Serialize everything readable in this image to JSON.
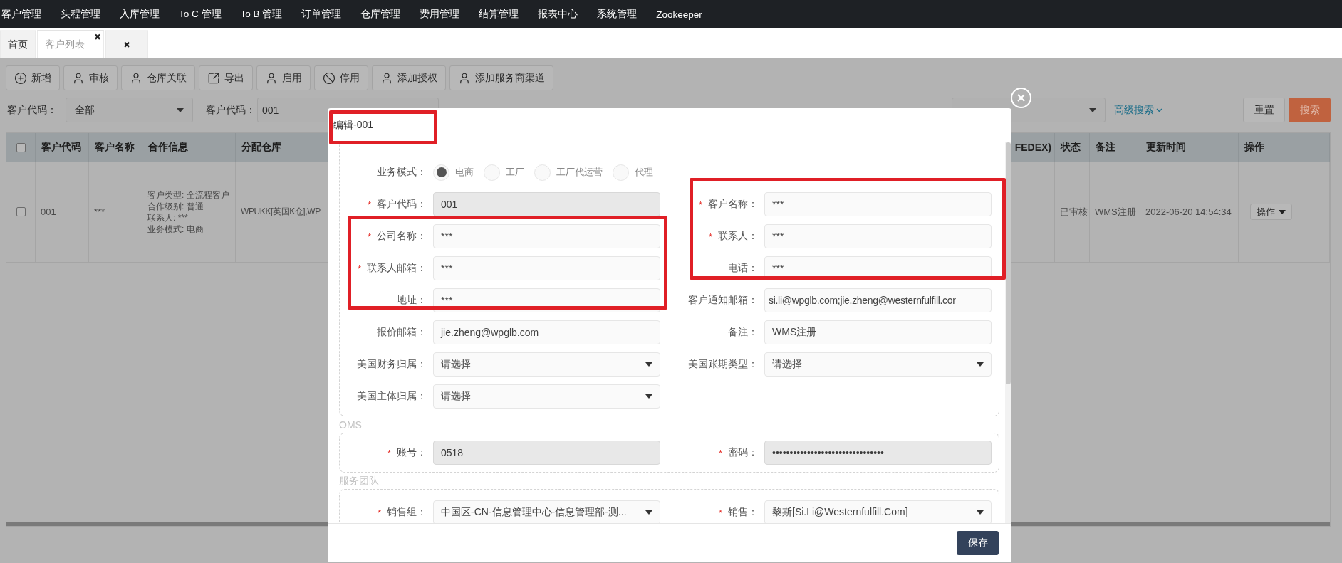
{
  "nav": {
    "items": [
      "客户管理",
      "头程管理",
      "入库管理",
      "To C 管理",
      "To B 管理",
      "订单管理",
      "仓库管理",
      "费用管理",
      "结算管理",
      "报表中心",
      "系统管理",
      "Zookeeper"
    ]
  },
  "tabs": [
    {
      "label": "首页",
      "selected": false
    },
    {
      "label": "客户列表",
      "selected": true,
      "close": "✖"
    },
    {
      "selected": false,
      "close": "✖"
    }
  ],
  "toolbar": [
    {
      "kind": "add",
      "label": "新增"
    },
    {
      "kind": "user",
      "label": "审核"
    },
    {
      "kind": "user",
      "label": "仓库关联"
    },
    {
      "kind": "export",
      "label": "导出"
    },
    {
      "kind": "user",
      "label": "启用"
    },
    {
      "kind": "ban",
      "label": "停用"
    },
    {
      "kind": "user",
      "label": "添加授权"
    },
    {
      "kind": "user",
      "label": "添加服务商渠道"
    }
  ],
  "filters": [
    {
      "kind": "select",
      "label": "客户代码：",
      "value": "全部"
    },
    {
      "kind": "input",
      "label": "客户代码：",
      "value": "001"
    },
    {
      "kind": "select"
    }
  ],
  "advanced_search": "高级搜索",
  "buttons": [
    {
      "kind": "reset",
      "label": "重置"
    },
    {
      "kind": "search",
      "label": "搜索"
    }
  ],
  "table": {
    "header_checked": false,
    "columns": [
      "客户代码",
      "客户名称",
      "合作信息",
      "分配仓库",
      "FEDEX)",
      "状态",
      "备注",
      "更新时间",
      "操作"
    ],
    "rows": [
      {
        "checked": false,
        "cells": [
          "001",
          "***",
          [
            "客户类型: 全流程客户",
            "合作级别: 普通",
            "联系人: ***",
            "业务模式: 电商"
          ],
          "WPUKK[英国K仓],WP",
          null,
          "已审核",
          "WMS注册",
          "2022-06-20 14:54:34"
        ],
        "action": "操作"
      }
    ]
  },
  "modal": {
    "title": "编辑-001",
    "save": "保存",
    "highlights": [
      {
        "kind": "title"
      },
      {
        "kind": "left-group"
      },
      {
        "kind": "right-group"
      }
    ],
    "sections": [
      {
        "rows": [
          {
            "left": {
              "kind": "radio",
              "label": "业务模式：",
              "options": [
                {
                  "label": "电商",
                  "selected": true
                },
                {
                  "label": "工厂",
                  "selected": false
                },
                {
                  "label": "工厂代运营",
                  "selected": false
                },
                {
                  "label": "代理",
                  "selected": false
                }
              ]
            }
          },
          {
            "left": {
              "kind": "input",
              "mark": "*",
              "label": "客户代码：",
              "value": "001",
              "disabled": true
            },
            "right": {
              "kind": "input",
              "mark": "*",
              "label": "客户名称：",
              "value": "***",
              "disabled": false
            }
          },
          {
            "left": {
              "kind": "input",
              "mark": "*",
              "label": "公司名称：",
              "value": "***",
              "disabled": false
            },
            "right": {
              "kind": "input",
              "mark": "*",
              "label": "联系人：",
              "value": "***",
              "disabled": false
            }
          },
          {
            "left": {
              "kind": "input",
              "mark": "*",
              "label": "联系人邮箱：",
              "value": "***",
              "disabled": false
            },
            "right": {
              "kind": "input",
              "label": "电话：",
              "value": "***",
              "disabled": false
            }
          },
          {
            "left": {
              "kind": "input",
              "label": "地址：",
              "value": "***",
              "disabled": false
            },
            "right": {
              "kind": "input",
              "label": "客户通知邮箱：",
              "value": "si.li@wpglb.com;jie.zheng@westernfulfill.cor",
              "disabled": false
            }
          },
          {
            "left": {
              "kind": "input",
              "label": "报价邮箱：",
              "value": "jie.zheng@wpglb.com",
              "disabled": false
            },
            "right": {
              "kind": "input",
              "label": "备注：",
              "value": "WMS注册",
              "disabled": false
            }
          },
          {
            "left": {
              "kind": "select",
              "label": "美国财务归属：",
              "value": "请选择"
            },
            "right": {
              "kind": "select",
              "label": "美国账期类型：",
              "value": "请选择"
            }
          },
          {
            "left": {
              "kind": "select",
              "label": "美国主体归属：",
              "value": "请选择"
            }
          }
        ]
      },
      {
        "title": "OMS",
        "rows": [
          {
            "left": {
              "kind": "input",
              "mark": "*",
              "label": "账号：",
              "value": "0518",
              "disabled": true
            },
            "right": {
              "kind": "input",
              "mark": "*",
              "label": "密码：",
              "value": "••••••••••••••••••••••••••••••••",
              "disabled": true
            }
          }
        ]
      },
      {
        "title": "服务团队",
        "rows": [
          {
            "left": {
              "kind": "select",
              "mark": "*",
              "label": "销售组：",
              "value": "中国区-CN-信息管理中心-信息管理部-测..."
            },
            "right": {
              "kind": "select",
              "mark": "*",
              "label": "销售：",
              "value": "黎斯[Si.Li@Westernfulfill.Com]"
            }
          }
        ]
      }
    ]
  }
}
